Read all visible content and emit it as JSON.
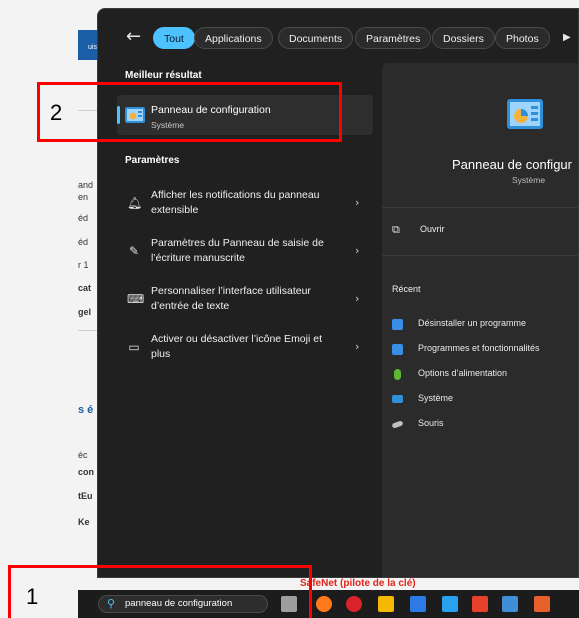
{
  "background": {
    "fragments": [
      "uis",
      "and",
      "en",
      "éd",
      "éd",
      "r 1",
      "cat",
      "gel",
      "s é",
      "éc",
      "con",
      "tEu",
      "Ke"
    ]
  },
  "search_panel": {
    "tabs": [
      {
        "label": "Tout",
        "active": true
      },
      {
        "label": "Applications",
        "active": false
      },
      {
        "label": "Documents",
        "active": false
      },
      {
        "label": "Paramètres",
        "active": false
      },
      {
        "label": "Dossiers",
        "active": false
      },
      {
        "label": "Photos",
        "active": false
      }
    ],
    "best_match": {
      "heading": "Meilleur résultat",
      "title": "Panneau de configuration",
      "subtitle": "Système"
    },
    "settings": {
      "heading": "Paramètres",
      "items": [
        {
          "label": "Afficher les notifications du panneau extensible",
          "icon": "bell-icon"
        },
        {
          "label": "Paramètres du Panneau de saisie de l’écriture manuscrite",
          "icon": "pen-icon"
        },
        {
          "label": "Personnaliser l’interface utilisateur d’entrée de texte",
          "icon": "keyboard-icon"
        },
        {
          "label": "Activer ou désactiver l’icône Emoji et plus",
          "icon": "emoji-panel-icon"
        }
      ]
    },
    "details": {
      "title": "Panneau de configur",
      "subtitle": "Système",
      "open_label": "Ouvrir",
      "recent_heading": "Récent",
      "recent_items": [
        {
          "label": "Désinstaller un programme",
          "icon": "control-panel-icon",
          "color": "#3a8ee6"
        },
        {
          "label": "Programmes et fonctionnalités",
          "icon": "control-panel-icon",
          "color": "#3a8ee6"
        },
        {
          "label": "Options d’alimentation",
          "icon": "power-icon",
          "color": "#5fb832"
        },
        {
          "label": "Système",
          "icon": "computer-icon",
          "color": "#2f8fd8"
        },
        {
          "label": "Souris",
          "icon": "mouse-icon",
          "color": "#bfbfbf"
        }
      ]
    }
  },
  "taskbar": {
    "search_text": "panneau de configuration",
    "app_colors": [
      "#9e9e9e",
      "#ff7a1a",
      "#d8232a",
      "#f5b800",
      "#2c7be5",
      "#2aa0f0",
      "#e8412b",
      "#3f8fd8",
      "#e8602c"
    ]
  },
  "overlay": {
    "banner_text": "SafeNet (pilote de la clé)",
    "annotation_1": "1",
    "annotation_2": "2"
  },
  "colors": {
    "accent": "#4cc2ff",
    "panel_bg": "#202020",
    "highlight_red": "#ff0000"
  }
}
